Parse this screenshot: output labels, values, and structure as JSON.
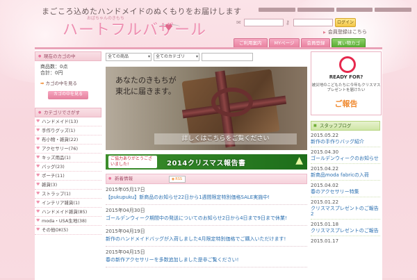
{
  "header": {
    "tagline": "まごころ込めたハンドメイドのぬくもりをお届けします",
    "logo_sub": "おばちゃんのきもち",
    "logo_main": "ハートフルバザール",
    "login_button": "ログイン",
    "register_link": "会員登録はこちら"
  },
  "global_nav": [
    {
      "label": "ご利用案内"
    },
    {
      "label": "MYページ"
    },
    {
      "label": "会員登録"
    },
    {
      "label": "買い物カゴ"
    }
  ],
  "cart": {
    "title": "現在のカゴの中",
    "line1": "商品数：0点",
    "line2": "合計：0円",
    "link": "カゴの中を見る",
    "button": "カゴの中を見る"
  },
  "categories": {
    "title": "カテゴリでさがす",
    "items": [
      {
        "label": "ハンドメイド(13)"
      },
      {
        "label": "手作りグッズ(1)"
      },
      {
        "label": "布小物・雑貨(22)"
      },
      {
        "label": "アクセサリー(76)"
      },
      {
        "label": "キッズ用品(1)"
      },
      {
        "label": "バッグ(23)"
      },
      {
        "label": "ポーチ(11)"
      },
      {
        "label": "雑貨(3)"
      },
      {
        "label": "ストラップ(1)"
      },
      {
        "label": "インテリア雑貨(1)"
      },
      {
        "label": "ハンドメイド雑貨(85)"
      },
      {
        "label": "moda・USA生地(38)"
      },
      {
        "label": "その他OK(5)"
      }
    ]
  },
  "search": {
    "select1": "全ての商品",
    "select2": "全てのカテゴリ"
  },
  "hero": {
    "line1": "あなたのきもちが",
    "line2": "東北に届きます。",
    "cta": "詳しくはこちらをご覧ください"
  },
  "banner": {
    "box": "ご協力ありがとうございました!",
    "text": "2014クリスマス報告書"
  },
  "news": {
    "title": "新着情報",
    "rss": "RSS",
    "items": [
      {
        "date": "2015年05月17日",
        "text": "【pukupuku】新商品のお知らせ22日から1週間限定特別価格SALE実施中!"
      },
      {
        "date": "2015年04月30日",
        "text": "ゴールデンウィーク期間中の発送についてのお知らせ2日から4日まで9日まで休業!"
      },
      {
        "date": "2015年04月19日",
        "text": "新作のハンドメイドバッグが入荷しました4月限定特別価格でご購入いただけます!"
      },
      {
        "date": "2015年04月15日",
        "text": "春の新作アクセサリーを多数追加しました是非ご覧ください!"
      }
    ]
  },
  "readyfor": {
    "title": "READY FOR?",
    "desc": "被災地のこどもたちに今年もクリスマスプレゼントを届けたい",
    "report": "ご報告"
  },
  "blog": {
    "title": "スタッフブログ",
    "items": [
      {
        "date": "2015.05.22",
        "text": "新作の手作りバッグ紹介"
      },
      {
        "date": "2015.04.30",
        "text": "ゴールデンウィークのお知らせ"
      },
      {
        "date": "2015.04.22",
        "text": "新商品moda fabricの入荷"
      },
      {
        "date": "2015.04.02",
        "text": "春のアクセサリー特集"
      },
      {
        "date": "2015.01.22",
        "text": "クリスマスプレゼントのご報告2"
      },
      {
        "date": "2015.01.18",
        "text": "クリスマスプレゼントのご報告"
      },
      {
        "date": "2015.01.17",
        "text": ""
      }
    ]
  }
}
